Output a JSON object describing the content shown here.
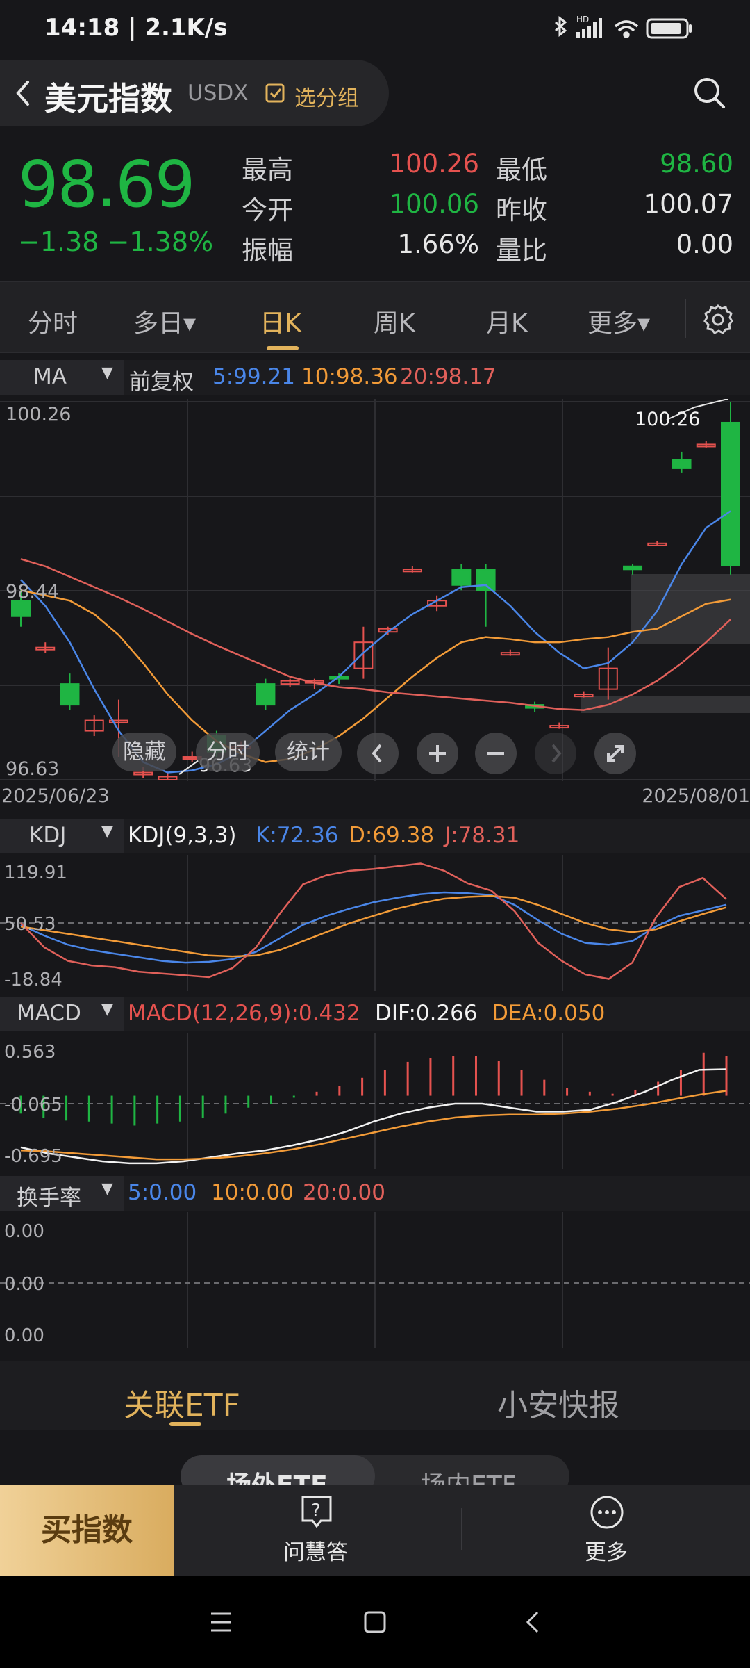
{
  "status_bar": {
    "time_speed": "14:18 | 2.1K/s",
    "network_badge": "HD"
  },
  "header": {
    "title": "美元指数",
    "code": "USDX",
    "group_button": "选分组"
  },
  "quote": {
    "price": "98.69",
    "change": "−1.38",
    "change_pct": "−1.38%",
    "high_label": "最高",
    "high": "100.26",
    "low_label": "最低",
    "low": "98.60",
    "open_label": "今开",
    "open": "100.06",
    "prev_close_label": "昨收",
    "prev_close": "100.07",
    "amplitude_label": "振幅",
    "amplitude": "1.66%",
    "volume_ratio_label": "量比",
    "volume_ratio": "0.00"
  },
  "period_tabs": [
    {
      "label": "分时"
    },
    {
      "label": "多日▾"
    },
    {
      "label": "日K"
    },
    {
      "label": "周K"
    },
    {
      "label": "月K"
    },
    {
      "label": "更多▾"
    }
  ],
  "active_tab": "日K",
  "ma_bar": {
    "selector": "MA",
    "adjust": "前复权",
    "ma5": "5:99.21",
    "ma10": "10:98.36",
    "ma20": "20:98.17"
  },
  "kline_panel": {
    "y_top": "100.26",
    "y_mid": "98.44",
    "y_bottom": "96.63",
    "max_marker": "100.26",
    "min_marker": "96.63",
    "date_start": "2025/06/23",
    "date_end": "2025/08/01"
  },
  "chart_controls": {
    "hide": "隐藏",
    "intraday": "分时",
    "stats": "统计"
  },
  "kdj_bar": {
    "selector": "KDJ",
    "params": "KDJ(9,3,3)",
    "k": "K:72.36",
    "d": "D:69.38",
    "j": "J:78.31",
    "y_top": "119.91",
    "y_mid": "50.53",
    "y_bottom": "-18.84"
  },
  "macd_bar": {
    "selector": "MACD",
    "params": "MACD(12,26,9):0.432",
    "dif": "DIF:0.266",
    "dea": "DEA:0.050",
    "y_top": "0.563",
    "y_mid": "-0.065",
    "y_bottom": "-0.695"
  },
  "turnover_bar": {
    "selector": "换手率",
    "v5": "5:0.00",
    "v10": "10:0.00",
    "v20": "20:0.00",
    "y_top": "0.00",
    "y_mid": "0.00",
    "y_bottom": "0.00"
  },
  "bottom_tabs": [
    {
      "label": "关联ETF"
    },
    {
      "label": "小安快报"
    }
  ],
  "etf_subtabs": [
    {
      "label": "场外ETF"
    },
    {
      "label": "场内ETF"
    }
  ],
  "bottom_actions": {
    "buy": "买指数",
    "ask": "问慧答",
    "more": "更多"
  },
  "colors": {
    "up": "#e5524f",
    "down": "#1fb543",
    "accent": "#e2b35c",
    "ma5": "#4a86e8",
    "ma10": "#f29b38",
    "ma20": "#e0605a"
  },
  "chart_data": [
    {
      "type": "candlestick",
      "title": "日K",
      "x_range": [
        "2025/06/23",
        "2025/08/01"
      ],
      "ylim": [
        96.63,
        100.26
      ],
      "candles": [
        {
          "o": 98.35,
          "c": 98.2,
          "h": 98.45,
          "l": 98.1
        },
        {
          "o": 97.9,
          "c": 97.9,
          "h": 97.95,
          "l": 97.85
        },
        {
          "o": 97.55,
          "c": 97.35,
          "h": 97.65,
          "l": 97.3
        },
        {
          "o": 97.1,
          "c": 97.2,
          "h": 97.25,
          "l": 97.05
        },
        {
          "o": 97.2,
          "c": 97.2,
          "h": 97.4,
          "l": 96.85
        },
        {
          "o": 96.7,
          "c": 96.7,
          "h": 96.75,
          "l": 96.65
        },
        {
          "o": 96.63,
          "c": 96.66,
          "h": 96.7,
          "l": 96.63
        },
        {
          "o": 96.85,
          "c": 96.85,
          "h": 96.9,
          "l": 96.8
        },
        {
          "o": 97.05,
          "c": 96.9,
          "h": 97.1,
          "l": 96.85
        },
        {
          "o": 96.95,
          "c": 96.95,
          "h": 97.0,
          "l": 96.9
        },
        {
          "o": 97.55,
          "c": 97.35,
          "h": 97.6,
          "l": 97.3
        },
        {
          "o": 97.55,
          "c": 97.58,
          "h": 97.6,
          "l": 97.52
        },
        {
          "o": 97.58,
          "c": 97.58,
          "h": 97.6,
          "l": 97.5
        },
        {
          "o": 97.62,
          "c": 97.6,
          "h": 97.65,
          "l": 97.55
        },
        {
          "o": 97.7,
          "c": 97.95,
          "h": 98.1,
          "l": 97.6
        },
        {
          "o": 98.05,
          "c": 98.08,
          "h": 98.1,
          "l": 98.02
        },
        {
          "o": 98.65,
          "c": 98.65,
          "h": 98.68,
          "l": 98.62
        },
        {
          "o": 98.3,
          "c": 98.35,
          "h": 98.4,
          "l": 98.25
        },
        {
          "o": 98.65,
          "c": 98.5,
          "h": 98.7,
          "l": 98.45
        },
        {
          "o": 98.65,
          "c": 98.45,
          "h": 98.7,
          "l": 98.1
        },
        {
          "o": 97.85,
          "c": 97.85,
          "h": 97.88,
          "l": 97.82
        },
        {
          "o": 97.35,
          "c": 97.32,
          "h": 97.38,
          "l": 97.28
        },
        {
          "o": 97.15,
          "c": 97.15,
          "h": 97.18,
          "l": 97.12
        },
        {
          "o": 97.45,
          "c": 97.45,
          "h": 97.48,
          "l": 97.42
        },
        {
          "o": 97.5,
          "c": 97.7,
          "h": 97.9,
          "l": 97.4
        },
        {
          "o": 98.68,
          "c": 98.65,
          "h": 98.7,
          "l": 98.6
        },
        {
          "o": 98.9,
          "c": 98.9,
          "h": 98.92,
          "l": 98.88
        },
        {
          "o": 99.7,
          "c": 99.62,
          "h": 99.78,
          "l": 99.58
        },
        {
          "o": 99.85,
          "c": 99.85,
          "h": 99.88,
          "l": 99.82
        },
        {
          "o": 100.06,
          "c": 98.69,
          "h": 100.26,
          "l": 98.6
        }
      ],
      "series": [
        {
          "name": "5",
          "values": [
            98.55,
            98.3,
            97.95,
            97.5,
            97.1,
            96.8,
            96.7,
            96.72,
            96.78,
            96.9,
            97.1,
            97.3,
            97.45,
            97.62,
            97.85,
            98.05,
            98.22,
            98.35,
            98.48,
            98.5,
            98.3,
            98.05,
            97.85,
            97.7,
            97.75,
            97.95,
            98.25,
            98.7,
            99.05,
            99.21
          ]
        },
        {
          "name": "10",
          "values": [
            98.45,
            98.4,
            98.35,
            98.22,
            98.02,
            97.75,
            97.45,
            97.2,
            97.0,
            96.88,
            96.8,
            96.83,
            96.92,
            97.05,
            97.22,
            97.42,
            97.62,
            97.8,
            97.95,
            98.0,
            97.98,
            97.95,
            97.95,
            97.98,
            98.0,
            98.05,
            98.08,
            98.2,
            98.32,
            98.36
          ]
        },
        {
          "name": "20",
          "values": [
            98.75,
            98.68,
            98.58,
            98.48,
            98.38,
            98.27,
            98.15,
            98.03,
            97.92,
            97.82,
            97.72,
            97.62,
            97.56,
            97.52,
            97.5,
            97.47,
            97.45,
            97.43,
            97.41,
            97.39,
            97.37,
            97.34,
            97.31,
            97.3,
            97.35,
            97.45,
            97.58,
            97.75,
            97.95,
            98.17
          ]
        }
      ]
    },
    {
      "type": "line",
      "title": "KDJ(9,3,3)",
      "ylim": [
        -18.84,
        119.91
      ],
      "series": [
        {
          "name": "K",
          "values": [
            50,
            38,
            28,
            22,
            18,
            14,
            10,
            8,
            9,
            12,
            20,
            35,
            50,
            60,
            68,
            75,
            80,
            84,
            86,
            85,
            83,
            72,
            55,
            40,
            30,
            28,
            32,
            48,
            60,
            66,
            72.36
          ]
        },
        {
          "name": "D",
          "values": [
            48,
            44,
            40,
            36,
            32,
            28,
            24,
            20,
            16,
            15,
            16,
            22,
            32,
            42,
            52,
            60,
            68,
            74,
            79,
            81,
            82,
            80,
            72,
            62,
            52,
            45,
            42,
            45,
            54,
            62,
            69.38
          ]
        },
        {
          "name": "J",
          "values": [
            52,
            25,
            10,
            5,
            3,
            -2,
            -4,
            -6,
            -8,
            2,
            25,
            62,
            95,
            105,
            110,
            112,
            115,
            118,
            110,
            96,
            88,
            65,
            30,
            10,
            -5,
            -10,
            8,
            58,
            92,
            102,
            78.31
          ]
        }
      ]
    },
    {
      "type": "bar",
      "title": "MACD(12,26,9):0.432",
      "ylim": [
        -0.695,
        0.563
      ],
      "values": [
        -0.18,
        -0.22,
        -0.25,
        -0.26,
        -0.28,
        -0.3,
        -0.28,
        -0.26,
        -0.22,
        -0.18,
        -0.12,
        -0.08,
        -0.02,
        0.04,
        0.1,
        0.18,
        0.26,
        0.34,
        0.38,
        0.4,
        0.4,
        0.35,
        0.26,
        0.16,
        0.08,
        0.04,
        0.02,
        0.06,
        0.14,
        0.26,
        0.432,
        0.4
      ],
      "series": [
        {
          "name": "DIF",
          "values": [
            -0.52,
            -0.58,
            -0.62,
            -0.66,
            -0.68,
            -0.68,
            -0.66,
            -0.62,
            -0.58,
            -0.55,
            -0.5,
            -0.44,
            -0.36,
            -0.26,
            -0.18,
            -0.12,
            -0.08,
            -0.08,
            -0.12,
            -0.16,
            -0.16,
            -0.14,
            -0.06,
            0.04,
            0.16,
            0.26,
            0.266
          ]
        },
        {
          "name": "DEA",
          "values": [
            -0.55,
            -0.56,
            -0.58,
            -0.6,
            -0.62,
            -0.64,
            -0.64,
            -0.63,
            -0.61,
            -0.58,
            -0.54,
            -0.49,
            -0.43,
            -0.37,
            -0.31,
            -0.26,
            -0.22,
            -0.2,
            -0.19,
            -0.19,
            -0.18,
            -0.16,
            -0.13,
            -0.09,
            -0.04,
            0.01,
            0.05
          ]
        }
      ]
    }
  ]
}
